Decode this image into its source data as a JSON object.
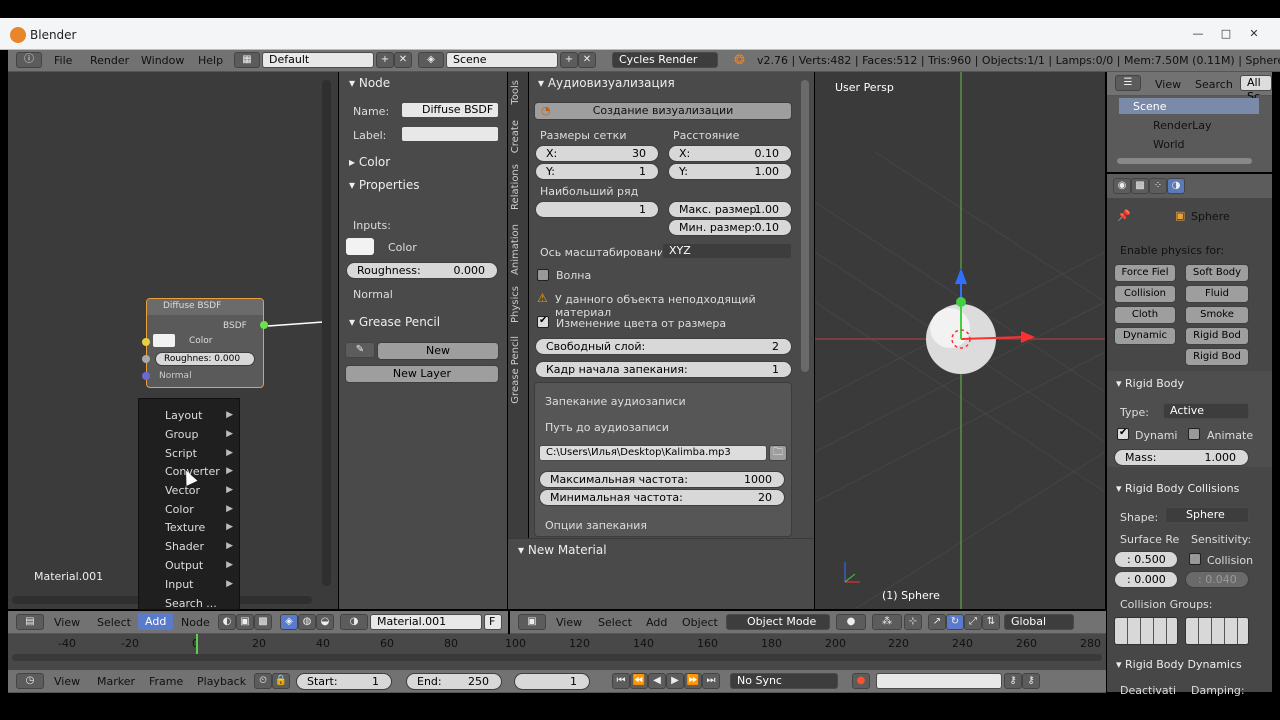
{
  "window": {
    "title": "Blender",
    "buttons": [
      "—",
      "□",
      "✕"
    ]
  },
  "topbar": {
    "menus": [
      "File",
      "Render",
      "Window",
      "Help"
    ],
    "layout": "Default",
    "scene": "Scene",
    "engine": "Cycles Render",
    "stats": "v2.76 | Verts:482 | Faces:512 | Tris:960 | Objects:1/1 | Lamps:0/0 | Mem:7.50M (0.11M) | Sphere"
  },
  "node_editor": {
    "node": {
      "title": "Diffuse BSDF",
      "output": "BSDF",
      "color": "Color",
      "roughness": "Roughnes: 0.000",
      "normal": "Normal"
    },
    "material_label": "Material.001",
    "header": {
      "view": "View",
      "select": "Select",
      "add": "Add",
      "node": "Node",
      "material": "Material.001",
      "f": "F"
    }
  },
  "add_menu": [
    "Layout",
    "Group",
    "Script",
    "Converter",
    "Vector",
    "Color",
    "Texture",
    "Shader",
    "Output",
    "Input",
    "Search ..."
  ],
  "node_panel": {
    "node_header": "Node",
    "name_label": "Name:",
    "name_value": "Diffuse BSDF",
    "label_label": "Label:",
    "color_header": "Color",
    "properties_header": "Properties",
    "inputs": "Inputs:",
    "color": "Color",
    "roughness_key": "Roughness:",
    "roughness_val": "0.000",
    "normal": "Normal",
    "grease_header": "Grease Pencil",
    "new": "New",
    "new_layer": "New Layer"
  },
  "tool_tabs": [
    "Tools",
    "Create",
    "Relations",
    "Animation",
    "Physics",
    "Grease Pencil"
  ],
  "audio_panel": {
    "header": "Аудиовизуализация",
    "create": "Создание визуализации",
    "grid": "Размеры сетки",
    "distance": "Расстояние",
    "gx": "X:",
    "gx_val": "30",
    "gy": "Y:",
    "gy_val": "1",
    "dx": "X:",
    "dx_val": "0.10",
    "dy": "Y:",
    "dy_val": "1.00",
    "max_row": "Наибольший ряд",
    "max_row_val": "1",
    "max_size": "Макс. размер:",
    "max_size_val": "1.00",
    "min_size": "Мин. размер:",
    "min_size_val": "0.10",
    "scale_axis": "Ось масштабирования",
    "scale_axis_val": "XYZ",
    "wave": "Волна",
    "warning": "У данного объекта неподходящий материал",
    "color_change": "Изменение цвета от размера",
    "free_layer": "Свободный слой:",
    "free_layer_val": "2",
    "bake_frame": "Кадр начала запекания:",
    "bake_frame_val": "1",
    "bake_audio": "Запекание аудиозаписи",
    "audio_path": "Путь до аудиозаписи",
    "path_val": "C:\\Users\\Илья\\Desktop\\Kalimba.mp3",
    "max_freq": "Максимальная частота:",
    "max_freq_val": "1000",
    "min_freq": "Минимальная частота:",
    "min_freq_val": "20",
    "bake_opts": "Опции запекания",
    "new_material": "New Material"
  },
  "viewport": {
    "label": "User Persp",
    "obj": "(1) Sphere",
    "header": {
      "view": "View",
      "select": "Select",
      "add": "Add",
      "object": "Object",
      "mode": "Object Mode",
      "orient": "Global"
    }
  },
  "outliner": {
    "view": "View",
    "search": "Search",
    "all": "All Sc",
    "items": [
      "Scene",
      "RenderLay",
      "World"
    ]
  },
  "properties": {
    "object": "Sphere",
    "enable_physics": "Enable physics for:",
    "phys_buttons": [
      "Force Fiel",
      "Soft Body",
      "Collision",
      "Fluid",
      "Cloth",
      "Smoke",
      "Dynamic",
      "Rigid Bod",
      "Rigid Bod"
    ],
    "rigid_body": "Rigid Body",
    "type_label": "Type:",
    "type_val": "Active",
    "dynamic": "Dynami",
    "animate": "Animate",
    "mass": "Mass:",
    "mass_val": "1.000",
    "collisions": "Rigid Body Collisions",
    "shape_label": "Shape:",
    "shape_val": "Sphere",
    "surface": "Surface Re",
    "sensitivity": "Sensitivity:",
    "friction": ": 0.500",
    "collision": "Collision",
    "bounce": ": 0.000",
    "margin": ": 0.040",
    "groups": "Collision Groups:",
    "dynamics": "Rigid Body Dynamics",
    "deact": "Deactivati",
    "damping": "Damping:"
  },
  "timeline": {
    "ticks": [
      "-40",
      "-20",
      "0",
      "20",
      "40",
      "60",
      "80",
      "100",
      "120",
      "140",
      "160",
      "180",
      "200",
      "220",
      "240",
      "260",
      "280"
    ],
    "view": "View",
    "marker": "Marker",
    "frame": "Frame",
    "playback": "Playback",
    "start": "Start:",
    "start_val": "1",
    "end": "End:",
    "end_val": "250",
    "current": "1",
    "sync": "No Sync"
  }
}
